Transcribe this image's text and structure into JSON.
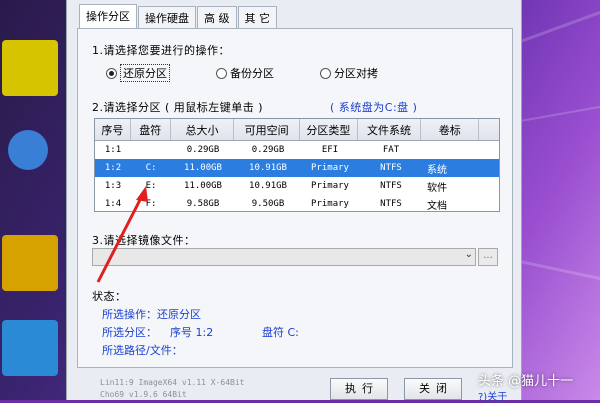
{
  "tabs": [
    {
      "label": "操作分区",
      "active": true
    },
    {
      "label": "操作硬盘",
      "active": false
    },
    {
      "label": "高 级",
      "active": false
    },
    {
      "label": "其 它",
      "active": false
    }
  ],
  "section1": {
    "title": "1.请选择您要进行的操作：",
    "options": [
      "还原分区",
      "备份分区",
      "分区对拷"
    ],
    "selected": "还原分区"
  },
  "section2": {
    "title": "2.请选择分区 ( 用鼠标左键单击 )",
    "system_disk": "( 系统盘为C:盘 )",
    "columns": [
      "序号",
      "盘符",
      "总大小",
      "可用空间",
      "分区类型",
      "文件系统",
      "卷标"
    ],
    "rows": [
      [
        "1:1",
        "",
        "0.29GB",
        "0.29GB",
        "EFI",
        "FAT",
        ""
      ],
      [
        "1:2",
        "C:",
        "11.00GB",
        "10.91GB",
        "Primary",
        "NTFS",
        "系统"
      ],
      [
        "1:3",
        "E:",
        "11.00GB",
        "10.91GB",
        "Primary",
        "NTFS",
        "软件"
      ],
      [
        "1:4",
        "F:",
        "9.58GB",
        "9.50GB",
        "Primary",
        "NTFS",
        "文档"
      ]
    ],
    "selected_row": 1
  },
  "section3": {
    "title": "3.请选择镜像文件：",
    "value": "",
    "browse_label": "..."
  },
  "status": {
    "title": "状态：",
    "operation_label": "所选操作：",
    "operation_value": "还原分区",
    "partition_label": "所选分区：",
    "partition_seq": "序号 1:2",
    "partition_drive": "盘符 C:",
    "path_label": "所选路径/文件："
  },
  "buttons": {
    "execute": "执行",
    "close": "关闭"
  },
  "version_lines": [
    "Lin11:9 ImageX64 v1.11 X-64Bit",
    "Cho69 v1.9.6 64Bit"
  ],
  "about_link": "?)关于",
  "watermark": "头条 @猫儿十一",
  "colors": {
    "selection": "#2b7ee0",
    "accent_text": "#1a3fd0",
    "arrow": "#e02020"
  }
}
